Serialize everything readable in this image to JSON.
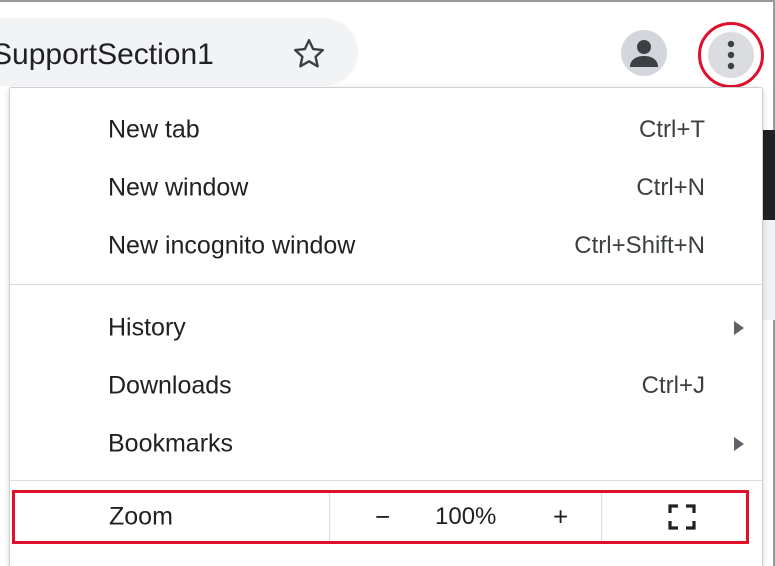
{
  "toolbar": {
    "omnibox_text": "SupportSection1",
    "star_icon": "star-outline-icon",
    "avatar_icon": "person-icon",
    "menu_icon": "three-dots-vertical-icon"
  },
  "menu": {
    "groups": [
      {
        "items": [
          {
            "label": "New tab",
            "shortcut": "Ctrl+T"
          },
          {
            "label": "New window",
            "shortcut": "Ctrl+N"
          },
          {
            "label": "New incognito window",
            "shortcut": "Ctrl+Shift+N"
          }
        ]
      },
      {
        "items": [
          {
            "label": "History",
            "shortcut": "",
            "submenu": true
          },
          {
            "label": "Downloads",
            "shortcut": "Ctrl+J"
          },
          {
            "label": "Bookmarks",
            "shortcut": "",
            "submenu": true
          }
        ]
      }
    ],
    "zoom": {
      "label": "Zoom",
      "minus": "−",
      "value": "100%",
      "plus": "+",
      "fullscreen_icon": "fullscreen-icon"
    }
  },
  "colors": {
    "highlight_red": "#e0102a",
    "text_primary": "#202124",
    "separator": "#dadce0",
    "omnibox_bg": "#f1f3f4"
  }
}
